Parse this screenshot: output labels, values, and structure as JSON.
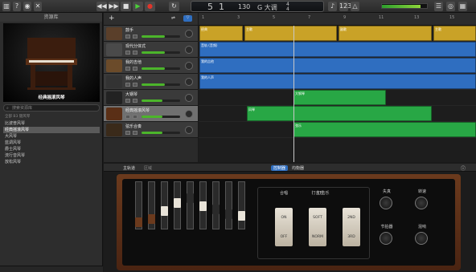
{
  "toolbar": {
    "lcd_bar": "5",
    "lcd_beat": "1",
    "lcd_tempo": "130",
    "lcd_key": "G 大调",
    "lcd_sig_top": "4",
    "lcd_sig_bottom": "4",
    "meter_level": 0.85
  },
  "library": {
    "title": "资源库",
    "preview_name": "经典摇滚风琴",
    "search_placeholder": "搜索资源库",
    "category": "全部 B3 键风琴",
    "items": [
      "比波普风琴",
      "经典摇滚风琴",
      "大风琴",
      "蓝调风琴",
      "爵士风琴",
      "流行音风琴",
      "放松风琴"
    ],
    "selected_index": 1
  },
  "tracks": [
    {
      "name": "鼓手",
      "volume": 0.6
    },
    {
      "name": "现代分体式",
      "volume": 0.6
    },
    {
      "name": "我的吉他",
      "volume": 0.6
    },
    {
      "name": "我的人声",
      "volume": 0.6
    },
    {
      "name": "大钢琴",
      "volume": 0.55
    },
    {
      "name": "经典摇滚风琴",
      "volume": 0.55
    },
    {
      "name": "弦乐合奏",
      "volume": 0.55
    }
  ],
  "arrange": {
    "ruler": [
      "1",
      "3",
      "5",
      "7",
      "9",
      "11",
      "13",
      "15"
    ],
    "regions": [
      {
        "lane": 0,
        "color": "y",
        "start": 1,
        "end": 55,
        "label": "经典"
      },
      {
        "lane": 0,
        "color": "y",
        "start": 57,
        "end": 172,
        "label": "主歌"
      },
      {
        "lane": 0,
        "color": "y",
        "start": 174,
        "end": 290,
        "label": "副歌"
      },
      {
        "lane": 0,
        "color": "y",
        "start": 292,
        "end": 345,
        "label": "主歌"
      },
      {
        "lane": 1,
        "color": "b",
        "start": 1,
        "end": 345,
        "label": "音轨 (音频)"
      },
      {
        "lane": 2,
        "color": "b",
        "start": 1,
        "end": 345,
        "label": "我的吉他"
      },
      {
        "lane": 3,
        "color": "b",
        "start": 1,
        "end": 345,
        "label": "我的人声"
      },
      {
        "lane": 4,
        "color": "g",
        "start": 118,
        "end": 233,
        "label": "大钢琴"
      },
      {
        "lane": 5,
        "color": "g",
        "start": 60,
        "end": 290,
        "label": "风琴"
      },
      {
        "lane": 6,
        "color": "g",
        "start": 118,
        "end": 345,
        "label": "弦乐"
      }
    ]
  },
  "editor": {
    "tab_main": "主轨道",
    "tab_region": "区域",
    "tab_controls": "控制器",
    "tab_effects": "均衡器",
    "rockers": [
      {
        "upper": "ON",
        "lower": "OFF",
        "label": "合唱"
      },
      {
        "upper": "SOFT",
        "lower": "NORM",
        "label": "打击乐"
      },
      {
        "upper": "2ND",
        "lower": "3RD",
        "label": ""
      }
    ],
    "section_percussion": "打击乐",
    "knobs": [
      "失真",
      "转速",
      "节拍器",
      "混响"
    ]
  }
}
